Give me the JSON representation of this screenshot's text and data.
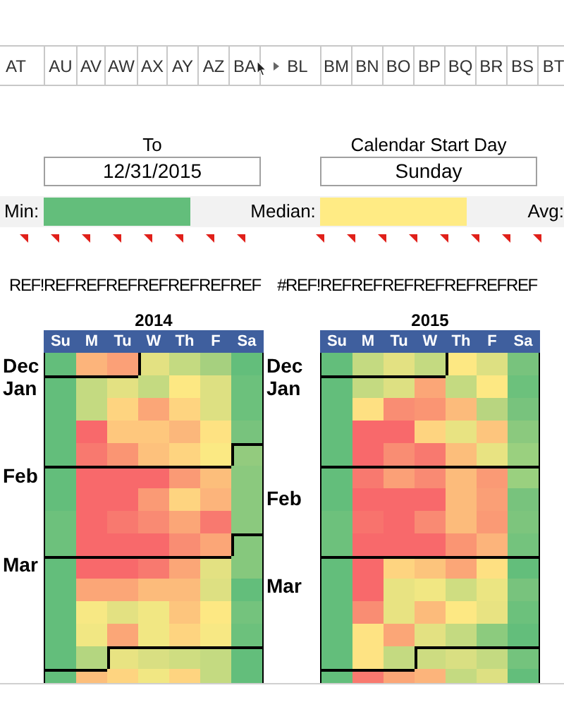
{
  "column_headers": [
    {
      "label": "AT"
    },
    {
      "label": "AU"
    },
    {
      "label": "AV"
    },
    {
      "label": "AW"
    },
    {
      "label": "AX"
    },
    {
      "label": "AY"
    },
    {
      "label": "AZ"
    },
    {
      "label": "BA",
      "pointer": true
    },
    {
      "label": "BL",
      "hidden_before": true
    },
    {
      "label": "BM"
    },
    {
      "label": "BN"
    },
    {
      "label": "BO"
    },
    {
      "label": "BP"
    },
    {
      "label": "BQ"
    },
    {
      "label": "BR"
    },
    {
      "label": "BS"
    },
    {
      "label": "BT"
    }
  ],
  "to_field": {
    "label": "To",
    "value": "12/31/2015"
  },
  "start_day_field": {
    "label": "Calendar Start Day",
    "value": "Sunday"
  },
  "legend": [
    {
      "label": "Min:",
      "color": "#63be7b"
    },
    {
      "label": "Median:",
      "color": "#ffeb84"
    },
    {
      "label": "Avg:"
    }
  ],
  "ref_row": [
    "REF!",
    "REF",
    "REF",
    "REF",
    "REF",
    "REF",
    "REF",
    "REF",
    "#REF!",
    "REF",
    "REF",
    "REF",
    "REF",
    "REF",
    "REF",
    "REF"
  ],
  "calendars": [
    {
      "year": "2014",
      "days": [
        "Su",
        "M",
        "Tu",
        "W",
        "Th",
        "F",
        "Sa"
      ],
      "rows": [
        {
          "label": "Dec",
          "cells": [
            {
              "color": "#63be7b"
            },
            {
              "color": "#fcb47b"
            },
            {
              "color": "#fba077"
            },
            {
              "color": "#e3e182",
              "month_start": true
            },
            {
              "color": "#c4da81"
            },
            {
              "color": "#a6d07f"
            },
            {
              "color": "#63be7b"
            }
          ]
        },
        {
          "label": "Jan",
          "cells": [
            {
              "color": "#63be7b"
            },
            {
              "color": "#c4da81"
            },
            {
              "color": "#e3e182"
            },
            {
              "color": "#c4da81"
            },
            {
              "color": "#fde883"
            },
            {
              "color": "#dde082"
            },
            {
              "color": "#6cc17c"
            }
          ]
        },
        {
          "cells": [
            {
              "color": "#63be7b"
            },
            {
              "color": "#c4da81"
            },
            {
              "color": "#fed480"
            },
            {
              "color": "#fba677"
            },
            {
              "color": "#fed480"
            },
            {
              "color": "#dde082"
            },
            {
              "color": "#6cc17c"
            }
          ]
        },
        {
          "cells": [
            {
              "color": "#63be7b"
            },
            {
              "color": "#f8696b"
            },
            {
              "color": "#fec77d"
            },
            {
              "color": "#fec77d"
            },
            {
              "color": "#fbb77b"
            },
            {
              "color": "#fee282"
            },
            {
              "color": "#78c37d"
            }
          ]
        },
        {
          "cells": [
            {
              "color": "#63be7b"
            },
            {
              "color": "#f8796f"
            },
            {
              "color": "#fa9573"
            },
            {
              "color": "#fdc17c"
            },
            {
              "color": "#fed480"
            },
            {
              "color": "#fbe983"
            },
            {
              "color": "#93cb7e",
              "month_start": true
            }
          ]
        },
        {
          "label": "Feb",
          "cells": [
            {
              "color": "#63be7b"
            },
            {
              "color": "#f8696b"
            },
            {
              "color": "#f8696b"
            },
            {
              "color": "#f8696b"
            },
            {
              "color": "#fa9a75"
            },
            {
              "color": "#fcbe7b"
            },
            {
              "color": "#8bc97e"
            }
          ]
        },
        {
          "cells": [
            {
              "color": "#63be7b"
            },
            {
              "color": "#f8696b"
            },
            {
              "color": "#f8696b"
            },
            {
              "color": "#fa9a75"
            },
            {
              "color": "#fed480"
            },
            {
              "color": "#fcb47b"
            },
            {
              "color": "#8bc97e"
            }
          ]
        },
        {
          "cells": [
            {
              "color": "#6dc17c"
            },
            {
              "color": "#f8696b"
            },
            {
              "color": "#f8796f"
            },
            {
              "color": "#f98a73"
            },
            {
              "color": "#fba677"
            },
            {
              "color": "#f8796f"
            },
            {
              "color": "#8bc97e"
            }
          ]
        },
        {
          "cells": [
            {
              "color": "#6dc17c"
            },
            {
              "color": "#f8696b"
            },
            {
              "color": "#f8696b"
            },
            {
              "color": "#f8696b"
            },
            {
              "color": "#f98d73"
            },
            {
              "color": "#fba677"
            },
            {
              "color": "#86c87d",
              "month_start": true
            }
          ]
        },
        {
          "label": "Mar",
          "cells": [
            {
              "color": "#63be7b"
            },
            {
              "color": "#f8696b"
            },
            {
              "color": "#f8696b"
            },
            {
              "color": "#f8796f"
            },
            {
              "color": "#fba677"
            },
            {
              "color": "#e3e182"
            },
            {
              "color": "#86c87d"
            }
          ]
        },
        {
          "cells": [
            {
              "color": "#63be7b"
            },
            {
              "color": "#fba677"
            },
            {
              "color": "#fba677"
            },
            {
              "color": "#fcbb7b"
            },
            {
              "color": "#fcbb7b"
            },
            {
              "color": "#dde082"
            },
            {
              "color": "#63be7b"
            }
          ]
        },
        {
          "cells": [
            {
              "color": "#63be7b"
            },
            {
              "color": "#f7e884"
            },
            {
              "color": "#e3e182"
            },
            {
              "color": "#f1e783"
            },
            {
              "color": "#fdc57d"
            },
            {
              "color": "#fde883"
            },
            {
              "color": "#74c37d"
            }
          ]
        },
        {
          "cells": [
            {
              "color": "#63be7b"
            },
            {
              "color": "#f1e783"
            },
            {
              "color": "#fba677"
            },
            {
              "color": "#f1e783"
            },
            {
              "color": "#fed480"
            },
            {
              "color": "#f7e884"
            },
            {
              "color": "#6cc17c"
            }
          ]
        },
        {
          "cells": [
            {
              "color": "#63be7b"
            },
            {
              "color": "#b4d680"
            },
            {
              "color": "#e8e382",
              "month_start": true
            },
            {
              "color": "#d9df82"
            },
            {
              "color": "#cfdd81"
            },
            {
              "color": "#c4da81"
            },
            {
              "color": "#63be7b"
            }
          ]
        },
        {
          "cells": [
            {
              "color": "#63be7b"
            },
            {
              "color": "#fcbe7b"
            },
            {
              "color": "#fed480"
            },
            {
              "color": "#f1e783"
            },
            {
              "color": "#fed480"
            },
            {
              "color": "#c4da81"
            },
            {
              "color": "#63be7b"
            }
          ]
        }
      ]
    },
    {
      "year": "2015",
      "days": [
        "Su",
        "M",
        "Tu",
        "W",
        "Th",
        "F",
        "Sa"
      ],
      "rows": [
        {
          "label": "Dec",
          "cells": [
            {
              "color": "#63be7b"
            },
            {
              "color": "#c4da81"
            },
            {
              "color": "#e3e182"
            },
            {
              "color": "#c4da81"
            },
            {
              "color": "#fde883",
              "month_start": true
            },
            {
              "color": "#dde082"
            },
            {
              "color": "#78c37d"
            }
          ]
        },
        {
          "label": "Jan",
          "cells": [
            {
              "color": "#63be7b"
            },
            {
              "color": "#c4da81"
            },
            {
              "color": "#dde082"
            },
            {
              "color": "#fba677"
            },
            {
              "color": "#c4da81"
            },
            {
              "color": "#fde883"
            },
            {
              "color": "#6cc17c"
            }
          ]
        },
        {
          "cells": [
            {
              "color": "#63be7b"
            },
            {
              "color": "#fee082"
            },
            {
              "color": "#f98d73"
            },
            {
              "color": "#fa9573"
            },
            {
              "color": "#fcbb7b"
            },
            {
              "color": "#b8d580"
            },
            {
              "color": "#78c37d"
            }
          ]
        },
        {
          "cells": [
            {
              "color": "#63be7b"
            },
            {
              "color": "#f8696b"
            },
            {
              "color": "#f8696b"
            },
            {
              "color": "#fed480"
            },
            {
              "color": "#e8e382"
            },
            {
              "color": "#fdc57d"
            },
            {
              "color": "#8bc97e"
            }
          ]
        },
        {
          "cells": [
            {
              "color": "#63be7b"
            },
            {
              "color": "#f8696b"
            },
            {
              "color": "#f98d73"
            },
            {
              "color": "#f8796f"
            },
            {
              "color": "#fcbe7b"
            },
            {
              "color": "#e8e382"
            },
            {
              "color": "#9ad07f"
            }
          ]
        },
        {
          "cells": [
            {
              "color": "#63be7b",
              "month_start": true
            },
            {
              "color": "#f8796f"
            },
            {
              "color": "#fba077"
            },
            {
              "color": "#f98a73"
            },
            {
              "color": "#fcbb7b"
            },
            {
              "color": "#fa9a75"
            },
            {
              "color": "#9ad07f"
            }
          ]
        },
        {
          "label": "Feb",
          "cells": [
            {
              "color": "#63be7b"
            },
            {
              "color": "#f8696b"
            },
            {
              "color": "#f8696b"
            },
            {
              "color": "#f8696b"
            },
            {
              "color": "#fcbb7b"
            },
            {
              "color": "#fa9f76"
            },
            {
              "color": "#78c37d"
            }
          ]
        },
        {
          "cells": [
            {
              "color": "#6dc17c"
            },
            {
              "color": "#f8736d"
            },
            {
              "color": "#f8696b"
            },
            {
              "color": "#f98a73"
            },
            {
              "color": "#fcbb7b"
            },
            {
              "color": "#fa9a75"
            },
            {
              "color": "#7dc57d"
            }
          ]
        },
        {
          "cells": [
            {
              "color": "#6dc17c"
            },
            {
              "color": "#f8696b"
            },
            {
              "color": "#f8696b"
            },
            {
              "color": "#f8696b"
            },
            {
              "color": "#fa9573"
            },
            {
              "color": "#fcb47b"
            },
            {
              "color": "#74c37d"
            }
          ]
        },
        {
          "cells": [
            {
              "color": "#63be7b",
              "month_start": true
            },
            {
              "color": "#f8696b"
            },
            {
              "color": "#fed480"
            },
            {
              "color": "#fcc47c"
            },
            {
              "color": "#fba677"
            },
            {
              "color": "#fee082"
            },
            {
              "color": "#63be7b"
            }
          ]
        },
        {
          "label": "Mar",
          "cells": [
            {
              "color": "#63be7b"
            },
            {
              "color": "#f8696b"
            },
            {
              "color": "#e8e382"
            },
            {
              "color": "#f1e783"
            },
            {
              "color": "#cfdd81"
            },
            {
              "color": "#ebe582"
            },
            {
              "color": "#78c37d"
            }
          ]
        },
        {
          "cells": [
            {
              "color": "#63be7b"
            },
            {
              "color": "#f98d73"
            },
            {
              "color": "#e8e382"
            },
            {
              "color": "#fcbb7b"
            },
            {
              "color": "#fde883"
            },
            {
              "color": "#e8e382"
            },
            {
              "color": "#6cc17c"
            }
          ]
        },
        {
          "cells": [
            {
              "color": "#63be7b"
            },
            {
              "color": "#fee383"
            },
            {
              "color": "#fba677"
            },
            {
              "color": "#e3e182"
            },
            {
              "color": "#c4da81"
            },
            {
              "color": "#8ccb7e"
            },
            {
              "color": "#63be7b"
            }
          ]
        },
        {
          "cells": [
            {
              "color": "#63be7b"
            },
            {
              "color": "#fee383"
            },
            {
              "color": "#c4da81"
            },
            {
              "color": "#cddc81",
              "month_start": true
            },
            {
              "color": "#d9df82"
            },
            {
              "color": "#c4da81"
            },
            {
              "color": "#74c37d"
            }
          ]
        },
        {
          "cells": [
            {
              "color": "#63be7b"
            },
            {
              "color": "#f8796f"
            },
            {
              "color": "#fba677"
            },
            {
              "color": "#fcb47b"
            },
            {
              "color": "#c4da81"
            },
            {
              "color": "#dde082"
            },
            {
              "color": "#63be7b"
            }
          ]
        }
      ]
    }
  ]
}
